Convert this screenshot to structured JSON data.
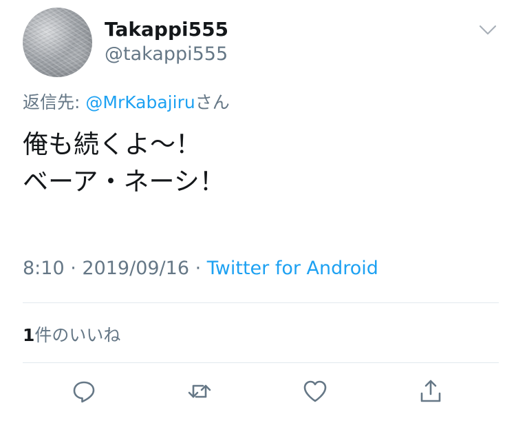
{
  "user": {
    "display_name": "Takappi555",
    "handle": "@takappi555"
  },
  "reply": {
    "prefix": "返信先: ",
    "mention": "@MrKabajiru",
    "suffix": "さん"
  },
  "tweet": {
    "line1": "俺も続くよ〜！",
    "line2": "ベーア・ネーシ！"
  },
  "meta": {
    "time": "8:10",
    "sep1": " · ",
    "date": "2019/09/16",
    "sep2": " · ",
    "source": "Twitter for Android"
  },
  "likes": {
    "count": "1",
    "label": "件のいいね"
  },
  "icons": {
    "avatar": "profile-avatar",
    "menu": "chevron-down-icon",
    "reply": "reply-icon",
    "retweet": "retweet-icon",
    "like": "heart-icon",
    "share": "share-icon"
  },
  "colors": {
    "text": "#14171a",
    "secondary": "#657786",
    "link": "#1da1f2",
    "divider": "#e1e8ed",
    "icon": "#657786"
  }
}
